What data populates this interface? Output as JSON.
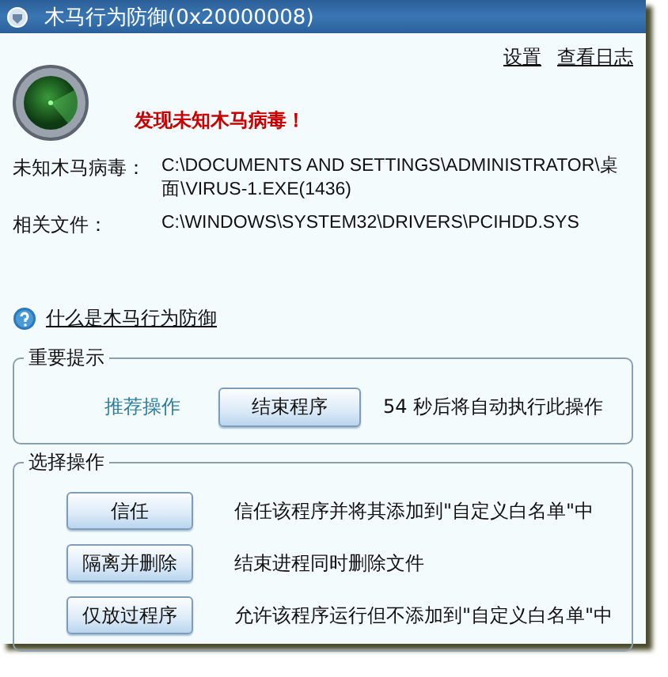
{
  "window": {
    "title": "木马行为防御(0x20000008)"
  },
  "header_links": [
    {
      "label": "设置"
    },
    {
      "label": "查看日志"
    }
  ],
  "alert": "发现未知木马病毒！",
  "details": [
    {
      "label": "未知木马病毒：",
      "value": "C:\\DOCUMENTS AND SETTINGS\\ADMINISTRATOR\\桌面\\VIRUS-1.EXE(1436)"
    },
    {
      "label": "相关文件：",
      "value": "C:\\WINDOWS\\SYSTEM32\\DRIVERS\\PCIHDD.SYS"
    }
  ],
  "help_link": "什么是木马行为防御",
  "important": {
    "title": "重要提示",
    "label": "推荐操作",
    "button": "结束程序",
    "countdown": "54 秒后将自动执行此操作"
  },
  "choices": {
    "title": "选择操作",
    "options": [
      {
        "button": "信任",
        "description": "信任该程序并将其添加到\"自定义白名单\"中"
      },
      {
        "button": "隔离并删除",
        "description": "结束进程同时删除文件"
      },
      {
        "button": "仅放过程序",
        "description": "允许该程序运行但不添加到\"自定义白名单\"中"
      }
    ]
  }
}
